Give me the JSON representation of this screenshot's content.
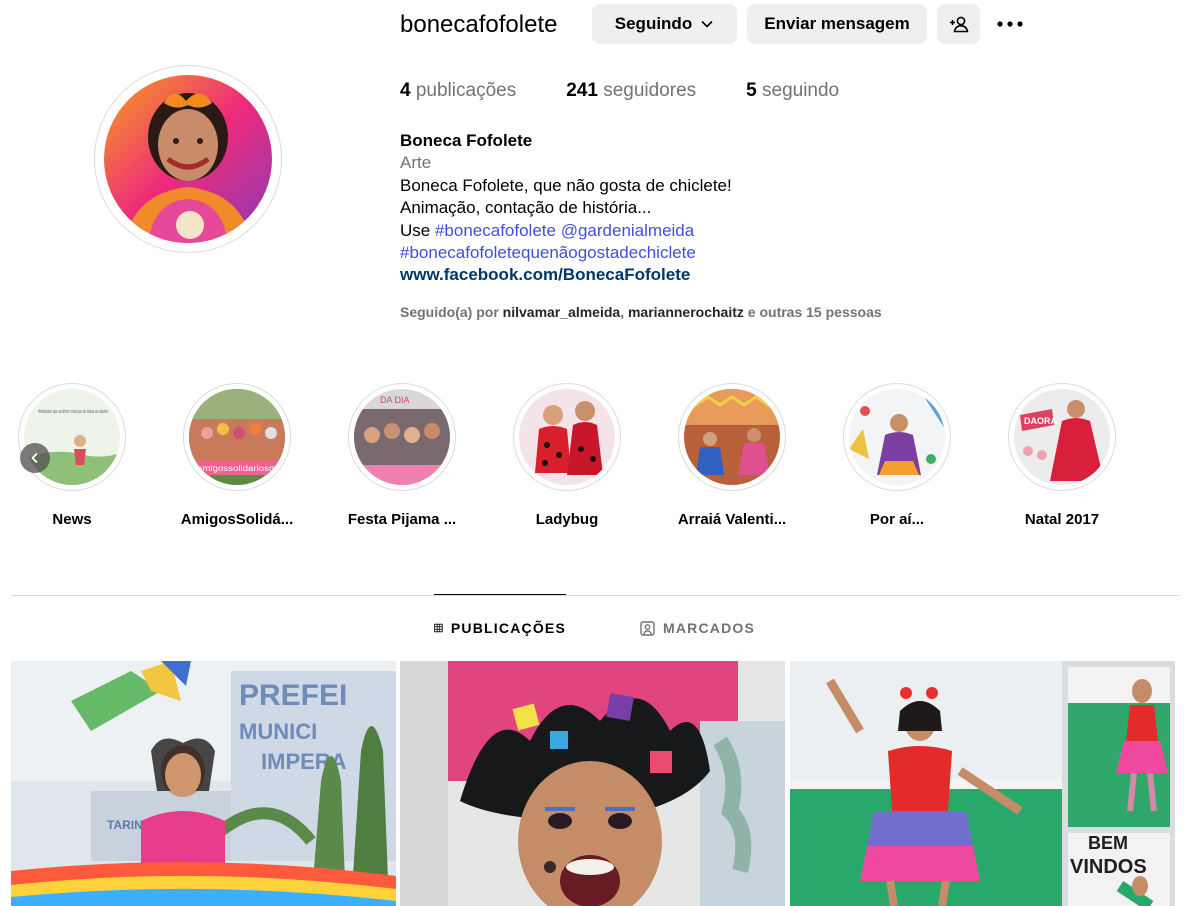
{
  "profile": {
    "username": "bonecafofolete",
    "following_button": "Seguindo",
    "message_button": "Enviar mensagem",
    "stats": {
      "posts_count": "4",
      "posts_label": "publicações",
      "followers_count": "241",
      "followers_label": "seguidores",
      "following_count": "5",
      "following_label": "seguindo"
    },
    "bio": {
      "name": "Boneca Fofolete",
      "category": "Arte",
      "line1": "Boneca Fofolete, que não gosta de chiclete!",
      "line2": "Animação, contação de história...",
      "line3_prefix": "Use ",
      "hashtag1": "#bonecafofolete",
      "mention": "@gardenialmeida",
      "hashtag2": "#bonecafofoletequenãogostadechiclete",
      "website": "www.facebook.com/BonecaFofolete"
    },
    "followed_by": {
      "prefix": "Seguido(a) por ",
      "user1": "nilvamar_almeida",
      "separator": ", ",
      "user2": "mariannerochaitz",
      "suffix": " e outras 15 pessoas"
    }
  },
  "highlights": [
    {
      "label": "News",
      "thumb_text": "Atividades que acolhem crianças de todas as idades"
    },
    {
      "label": "AmigosSolidá...",
      "thumb_text": "amigossolidariosm"
    },
    {
      "label": "Festa Pijama ...",
      "thumb_text": "DA DIA"
    },
    {
      "label": "Ladybug"
    },
    {
      "label": "Arraiá Valenti..."
    },
    {
      "label": "Por aí..."
    },
    {
      "label": "Natal 2017",
      "thumb_text": "DAORA"
    }
  ],
  "tabs": {
    "posts": "PUBLICAÇÕES",
    "tagged": "MARCADOS"
  },
  "posts": [
    {
      "sign_text_1": "PREFEI",
      "sign_text_2": "MUNICI",
      "sign_text_3": "IMPERA",
      "sign_text_4": "TARIN"
    },
    {},
    {
      "sign_text_1": "BEM",
      "sign_text_2": "VINDOS"
    }
  ],
  "colors": {
    "tag_blue": "#3f51d8",
    "link_navy": "#00376b",
    "secondary_gray": "#737373",
    "button_bg": "#efefef",
    "border": "#dbdbdb"
  },
  "icons": {
    "following_chevron": "chevron-down-icon",
    "suggest": "person-add-icon",
    "more": "more-horizontal-icon",
    "prev": "chevron-left-icon",
    "posts_tab": "grid-icon",
    "tagged_tab": "tagged-person-icon"
  }
}
